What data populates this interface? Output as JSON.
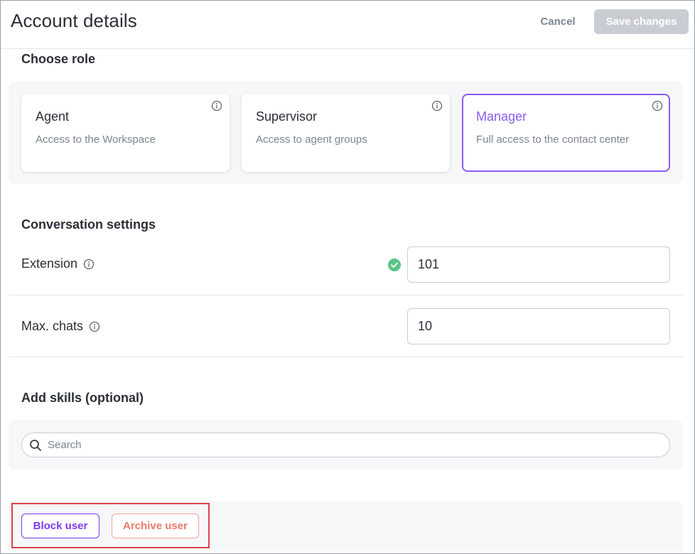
{
  "header": {
    "title": "Account details",
    "cancel_label": "Cancel",
    "save_label": "Save changes"
  },
  "role_section": {
    "title": "Choose role",
    "roles": [
      {
        "name": "Agent",
        "description": "Access to the Workspace",
        "selected": false
      },
      {
        "name": "Supervisor",
        "description": "Access to agent groups",
        "selected": false
      },
      {
        "name": "Manager",
        "description": "Full access to the contact center",
        "selected": true
      }
    ]
  },
  "conversation_section": {
    "title": "Conversation settings",
    "extension": {
      "label": "Extension",
      "value": "101",
      "status": "valid"
    },
    "max_chats": {
      "label": "Max. chats",
      "value": "10"
    }
  },
  "skills_section": {
    "title": "Add skills (optional)",
    "search_placeholder": "Search"
  },
  "footer": {
    "block_label": "Block user",
    "archive_label": "Archive user"
  },
  "colors": {
    "accent": "#8b5cf6",
    "danger": "#ea7a69",
    "highlight": "#e0414a",
    "success": "#5cc488"
  },
  "icons": [
    "info-icon",
    "check-circle-icon",
    "search-icon"
  ]
}
